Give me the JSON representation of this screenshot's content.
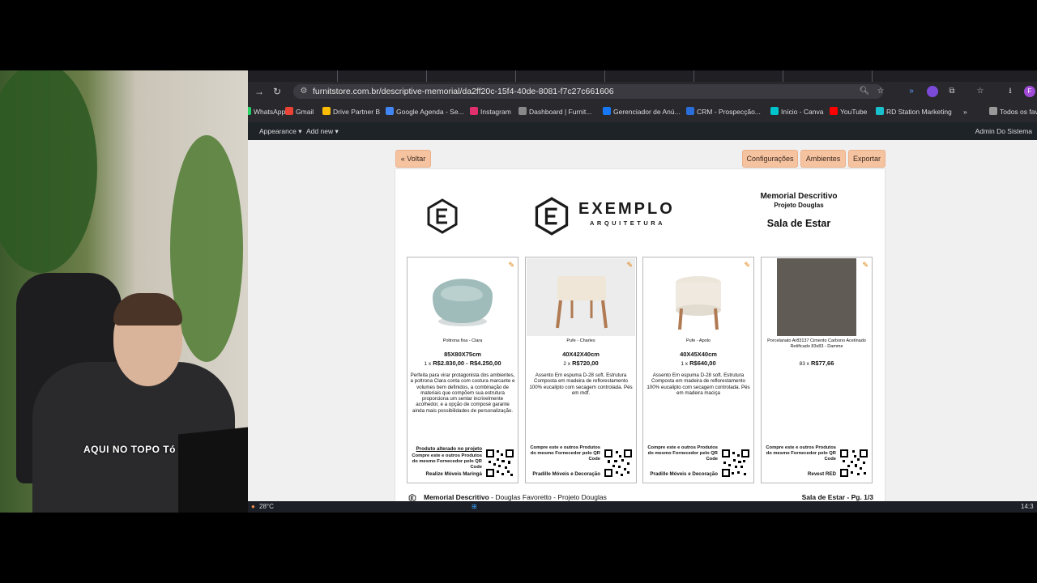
{
  "overlay": {
    "caption": "AQUI NO TOPO Tó"
  },
  "browser": {
    "url": "furnitstore.com.br/descriptive-memorial/da2ff20c-15f4-40de-8081-f7c27c661606",
    "bookmarks": [
      {
        "label": "WhatsApp",
        "color": "#25d366"
      },
      {
        "label": "Gmail",
        "color": "#ea4335"
      },
      {
        "label": "Drive Partner B",
        "color": "#fbbc04"
      },
      {
        "label": "Google Agenda - Se...",
        "color": "#4285f4"
      },
      {
        "label": "Instagram",
        "color": "#e1306c"
      },
      {
        "label": "Dashboard | Furnit...",
        "color": "#888888"
      },
      {
        "label": "Gerenciador de Anú...",
        "color": "#1877f2"
      },
      {
        "label": "CRM - Prospecção...",
        "color": "#2a6edb"
      },
      {
        "label": "Início - Canva",
        "color": "#00c4cc"
      },
      {
        "label": "YouTube",
        "color": "#ff0000"
      },
      {
        "label": "RD Station Marketing",
        "color": "#19c1ce"
      },
      {
        "label": "»",
        "color": ""
      },
      {
        "label": "Todos os fav",
        "color": "#999999"
      }
    ]
  },
  "wpbar": {
    "appearance": "Appearance",
    "add_new": "Add new",
    "user": "Admin Do Sistema"
  },
  "toolbar": {
    "back": "« Voltar",
    "config": "Configurações",
    "rooms": "Ambientes",
    "export": "Exportar"
  },
  "header": {
    "brand": "EXEMPLO",
    "brand_sub": "ARQUITETURA",
    "title": "Memorial Descritivo",
    "project": "Projeto Douglas",
    "room": "Sala de Estar"
  },
  "products": [
    {
      "name": "Poltrona fixa - Clara",
      "dims": "85X80X75cm",
      "qty": "1 x",
      "price": "R$2.830,00 - R$4.250,00",
      "desc": "Perfeita para virar protagonista dos ambientes, a poltrona Clara conta com costura marcante e volumes bem definidos, a combinação de materiais que compõem sua estrutura proporciona um sentar incrivelmente acolhedor, e a opção de composé garante ainda mais possibilidades de personalização.",
      "altered": "Produto alterado no projeto",
      "buy": "Compre este e outros Produtos do mesmo Fornecedor pelo QR Code",
      "supplier": "Realize Móveis Maringá"
    },
    {
      "name": "Pufe - Charles",
      "dims": "40X42X40cm",
      "qty": "2 x",
      "price": "R$720,00",
      "desc": "Assento Em espuma D-28 soft. Estrutura Composta em madeira de reflorestamento 100% eucalipto com secagem controlada. Pés em mdf.",
      "altered": "",
      "buy": "Compre este e outros Produtos do mesmo Fornecedor pelo QR Code",
      "supplier": "Pradille Móveis e Decoração"
    },
    {
      "name": "Pufe - Apolo",
      "dims": "40X45X40cm",
      "qty": "1 x",
      "price": "R$640,00",
      "desc": "Assento Em espuma D-28 soft. Estrutura Composta em madeira de reflorestamento 100% eucalipto com secagem controlada. Pés em madeira maciça",
      "altered": "",
      "buy": "Compre este e outros Produtos do mesmo Fornecedor pelo QR Code",
      "supplier": "Pradille Móveis e Decoração"
    },
    {
      "name": "Porcelanato Ar83137 Cimento Carbono Acetinado Retificado 83x83 - Damme",
      "dims": "",
      "qty": "83 x",
      "price": "R$77,66",
      "desc": "",
      "altered": "",
      "buy": "Compre este e outros Produtos do mesmo Fornecedor pelo QR Code",
      "supplier": "Revest RED"
    }
  ],
  "footer": {
    "left_bold": "Memorial Descritivo",
    "left_rest": " - Douglas Favoretto - Projeto Douglas",
    "right": "Sala de Estar - Pg. 1/3"
  },
  "taskbar": {
    "temp": "28°C",
    "time": "14:3"
  }
}
